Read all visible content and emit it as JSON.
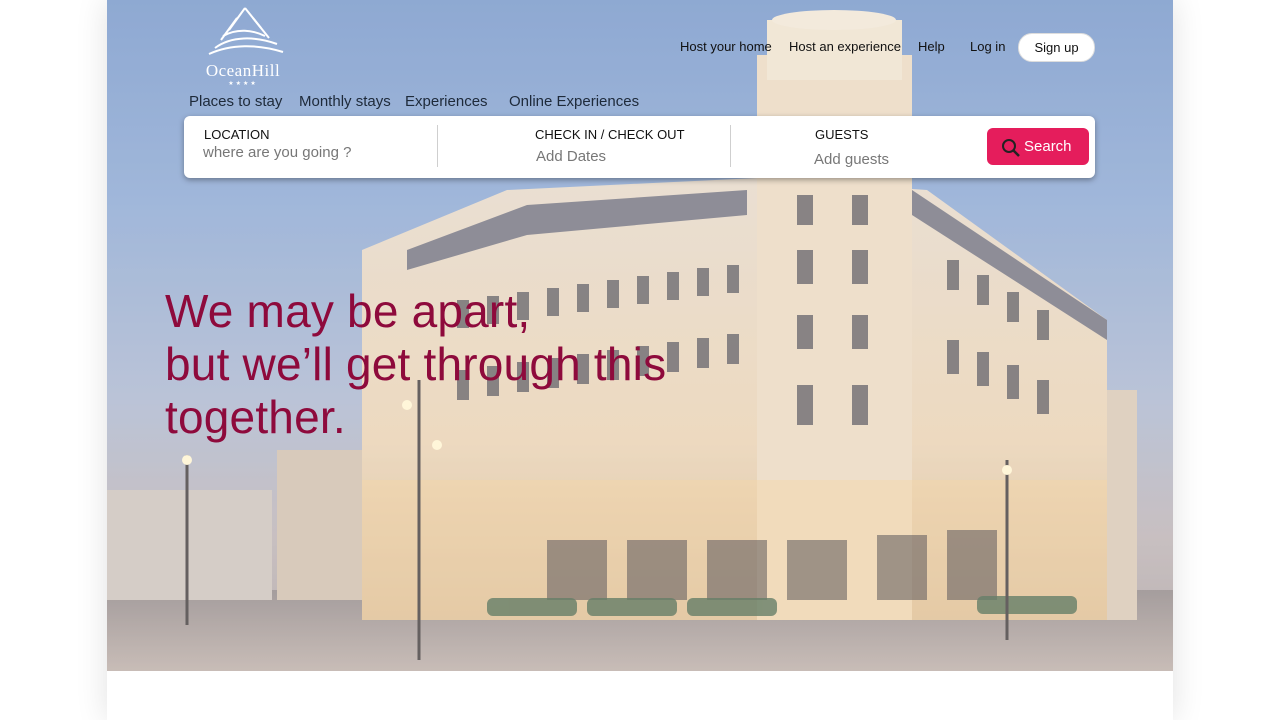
{
  "brand": {
    "name": "OceanHill",
    "stars": "★★★★"
  },
  "nav": {
    "host_home": "Host your home",
    "host_experience": "Host an experience",
    "help": "Help",
    "login": "Log in",
    "signup": "Sign up"
  },
  "tabs": [
    "Places to stay",
    "Monthly stays",
    "Experiences",
    "Online Experiences"
  ],
  "search": {
    "location_label": "LOCATION",
    "location_placeholder": "where are you going ?",
    "dates_label": "CHECK IN / CHECK OUT",
    "dates_placeholder": "Add Dates",
    "guests_label": "GUESTS",
    "guests_placeholder": "Add  guests",
    "button": "Search"
  },
  "hero": {
    "line1": "We may be apart,",
    "line2": "but we’ll get through this",
    "line3": "together."
  },
  "colors": {
    "accent": "#e51d5c",
    "headline": "#8e0a3c"
  }
}
